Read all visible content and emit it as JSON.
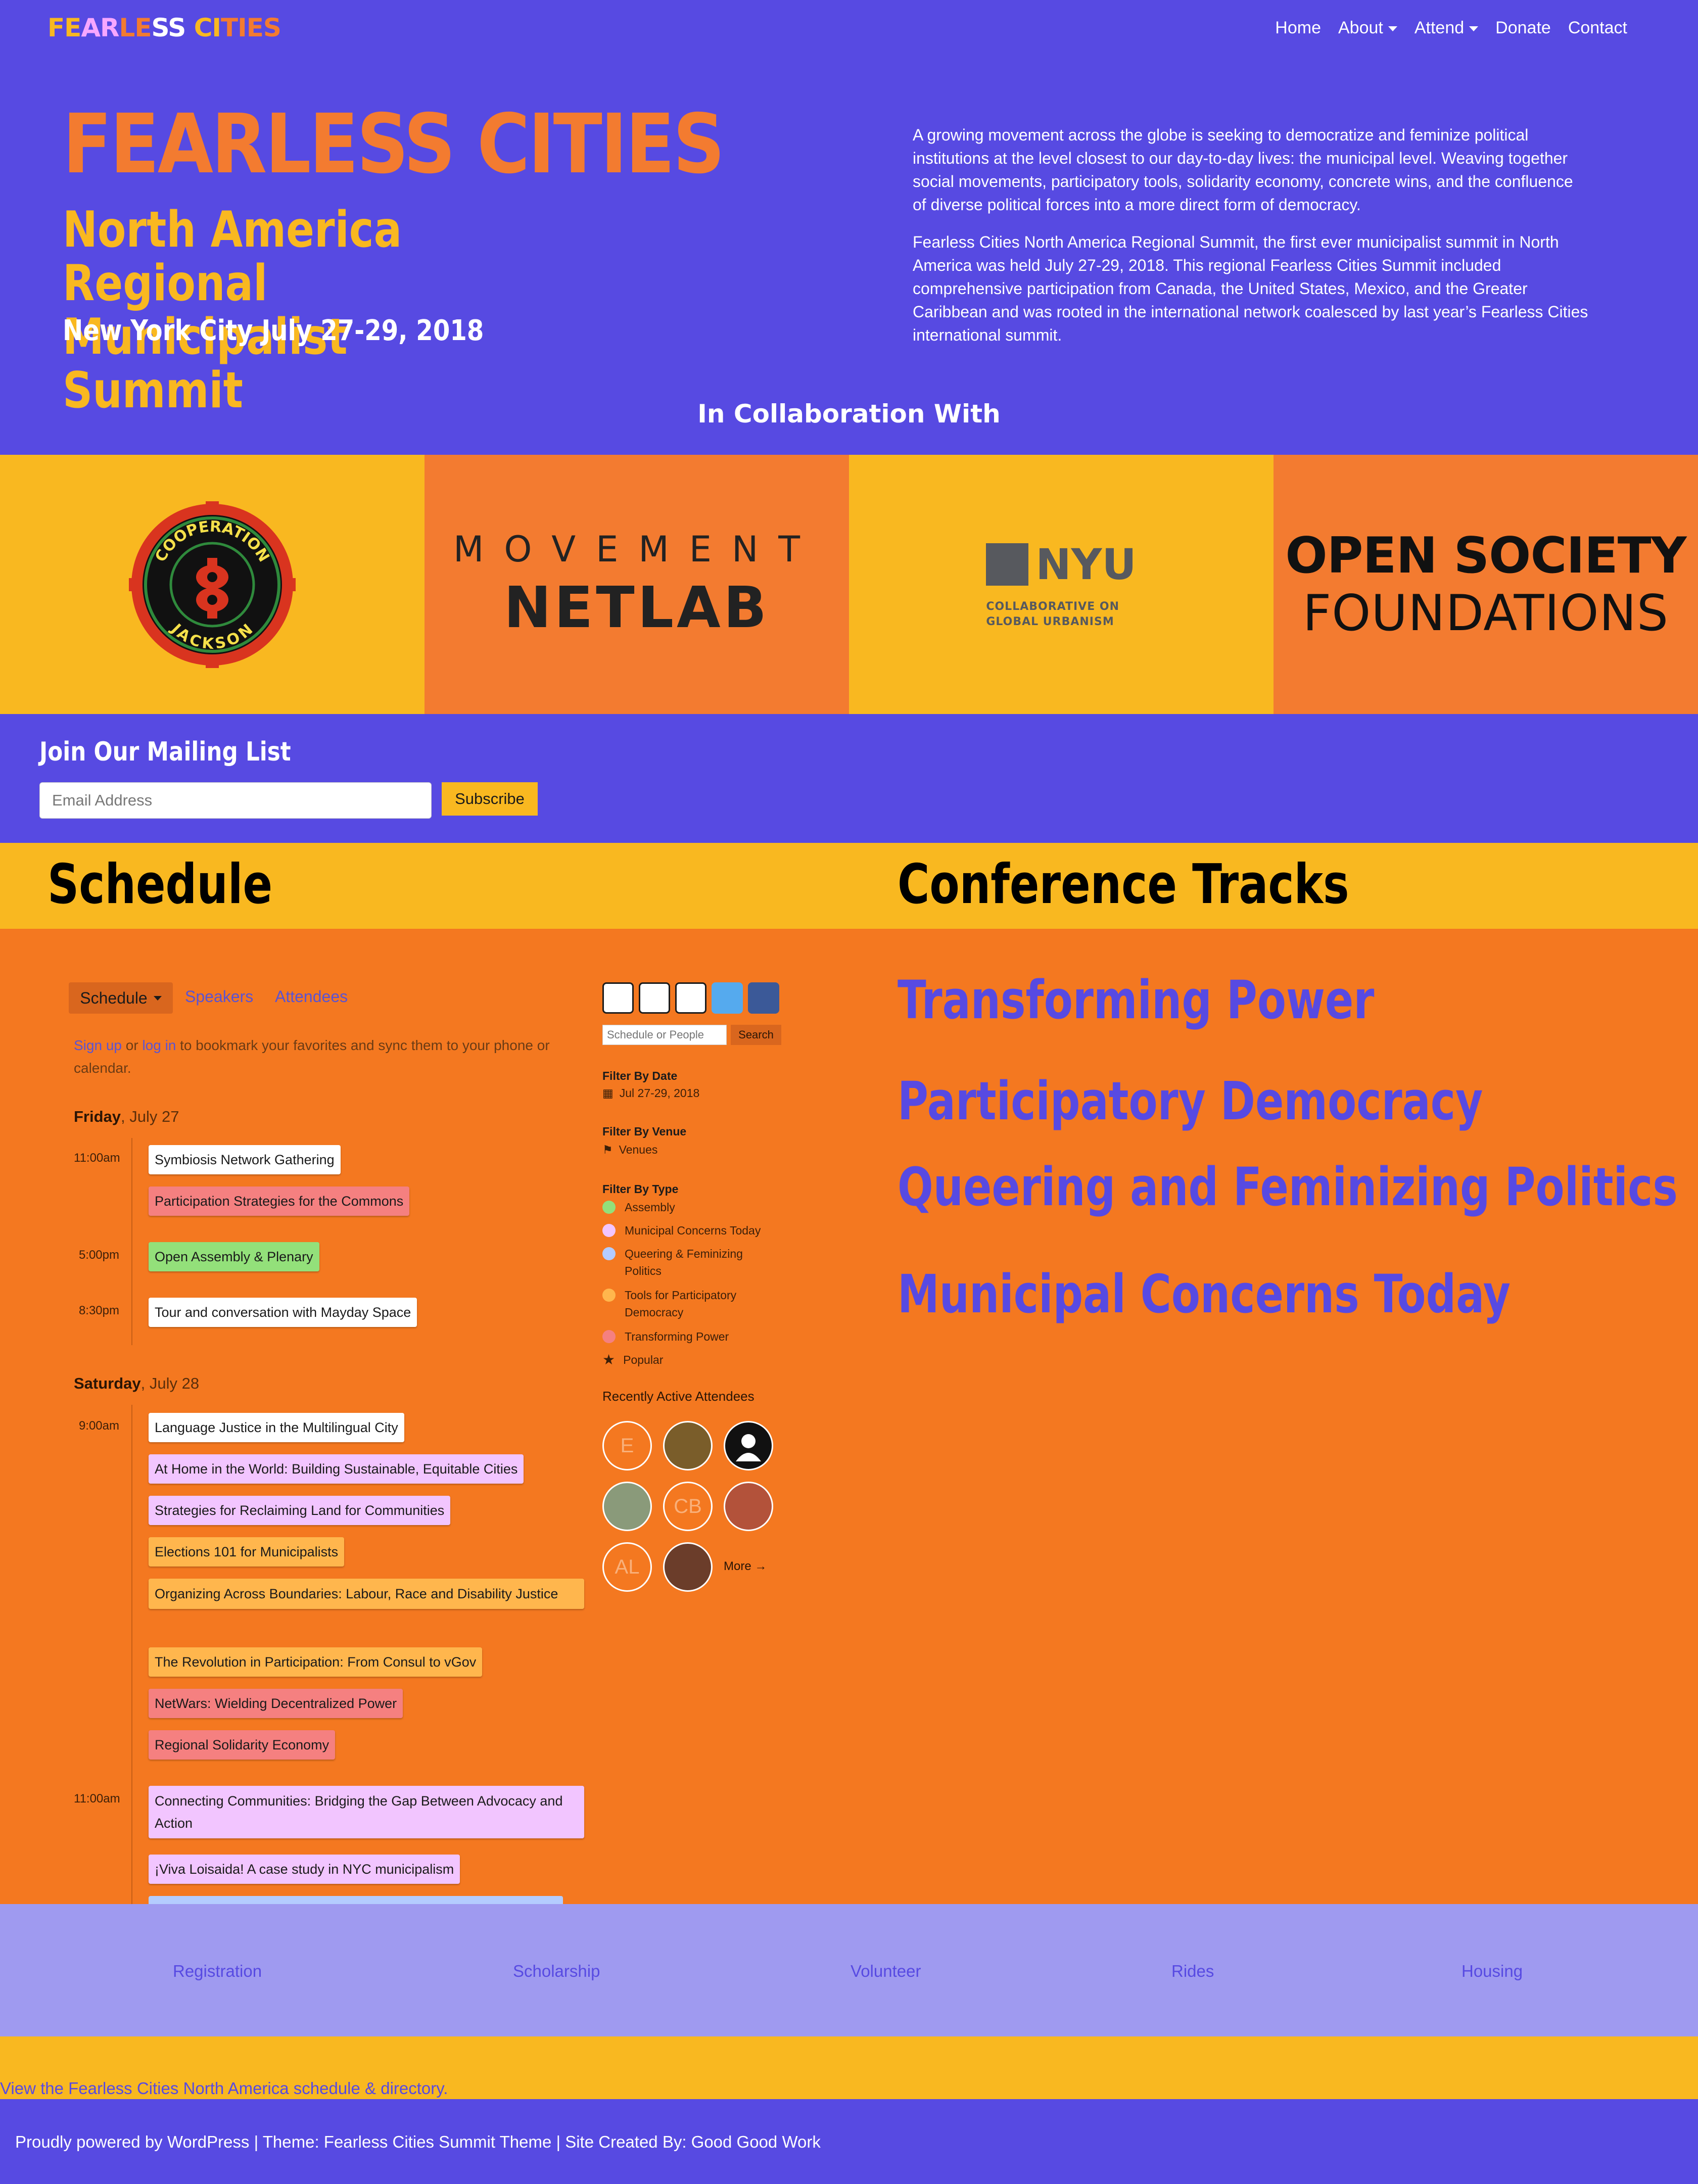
{
  "nav": {
    "logo": [
      "FE",
      "AR",
      "LE",
      "SS ",
      "CI",
      "TIES"
    ],
    "items": [
      "Home",
      "About",
      "Attend",
      "Donate",
      "Contact"
    ]
  },
  "hero": {
    "title": "FEARLESS CITIES",
    "subtitle": "North America Regional Municipalist Summit",
    "date": "New York City July 27-29, 2018",
    "paragraphs": [
      "A growing movement across the globe is seeking to democratize and feminize political institutions at the level closest to our day-to-day lives: the municipal level. Weaving together social movements, participatory tools, solidarity economy, concrete wins, and the confluence of diverse political forces into a more direct form of democracy.",
      "Fearless Cities North America Regional Summit, the first ever municipalist summit in North America was held July 27-29, 2018. This regional Fearless Cities Summit included comprehensive participation from Canada, the United States, Mexico, and the Greater Caribbean and was rooted in the international network coalesced by last year’s Fearless Cities international summit."
    ],
    "collab_heading": "In Collaboration With"
  },
  "partners": {
    "cooperation_jackson": [
      "COOPERATION",
      "JACKSON"
    ],
    "movement_netlab": [
      "MOVEMENT",
      "NETLAB"
    ],
    "nyu": [
      "NYU",
      "COLLABORATIVE ON",
      "GLOBAL URBANISM"
    ],
    "osf": [
      "OPEN SOCIETY",
      "FOUNDATIONS"
    ]
  },
  "mailing": {
    "heading": "Join Our Mailing List",
    "placeholder": "Email Address",
    "button": "Subscribe"
  },
  "schedule": {
    "heading": "Schedule",
    "tabs": [
      "Schedule",
      "Speakers",
      "Attendees"
    ],
    "signup": [
      "Sign up",
      " or ",
      "log in",
      " to bookmark your favorites and sync them to your phone or calendar."
    ],
    "days": [
      {
        "day": "Friday",
        "date": ", July 27"
      },
      {
        "day": "Saturday",
        "date": ", July 28"
      }
    ],
    "times": [
      "11:00am",
      "5:00pm",
      "8:30pm",
      "9:00am",
      "11:00am"
    ],
    "events": [
      "Symbiosis Network Gathering",
      "Participation Strategies for the Commons",
      "Open Assembly & Plenary",
      "Tour and conversation with Mayday Space",
      "Language Justice in the Multilingual City",
      "At Home in the World: Building Sustainable, Equitable Cities",
      "Strategies for Reclaiming Land for Communities",
      "Elections 101 for Municipalists",
      "Organizing Across Boundaries: Labour, Race and Disability Justice",
      "The Revolution in Participation: From Consul to vGov",
      "NetWars: Wielding Decentralized Power",
      "Regional Solidarity Economy",
      "Connecting Communities: Bridging the Gap Between Advocacy and Action",
      "¡Viva Loisaida! A case study in NYC municipalism"
    ],
    "search_placeholder": "Schedule or People",
    "search_button": "Search",
    "filters": {
      "date_h": "Filter By Date",
      "date_v": "Jul 27-29, 2018",
      "venue_h": "Filter By Venue",
      "venue_v": "Venues",
      "type_h": "Filter By Type",
      "types": [
        "Assembly",
        "Municipal Concerns Today",
        "Queering & Feminizing Politics",
        "Tools for Participatory Democracy",
        "Transforming Power",
        "Popular"
      ],
      "type_colors": [
        "#93e07a",
        "#f2c5ff",
        "#b4ccff",
        "#ffb64d",
        "#f58080"
      ]
    },
    "recent_heading": "Recently Active Attendees",
    "attendee_initials": [
      "E",
      "CB",
      "AL"
    ],
    "more": "More →"
  },
  "tracks": {
    "heading": "Conference Tracks",
    "items": [
      "Transforming Power",
      "Participatory Democracy",
      "Queering and Feminizing Politics",
      "Municipal Concerns Today"
    ]
  },
  "bottom": {
    "links": [
      "Registration",
      "Scholarship",
      "Volunteer",
      "Rides",
      "Housing"
    ],
    "view_link": "View the Fearless Cities North America schedule & directory.",
    "footer": "Proudly powered by WordPress | Theme: Fearless Cities Summit Theme | Site Created By: Good Good Work"
  },
  "colors": {
    "purple": "#574ae2",
    "orange": "#f37b30",
    "yellow": "#f9b820",
    "lavender": "#9f9af0"
  }
}
